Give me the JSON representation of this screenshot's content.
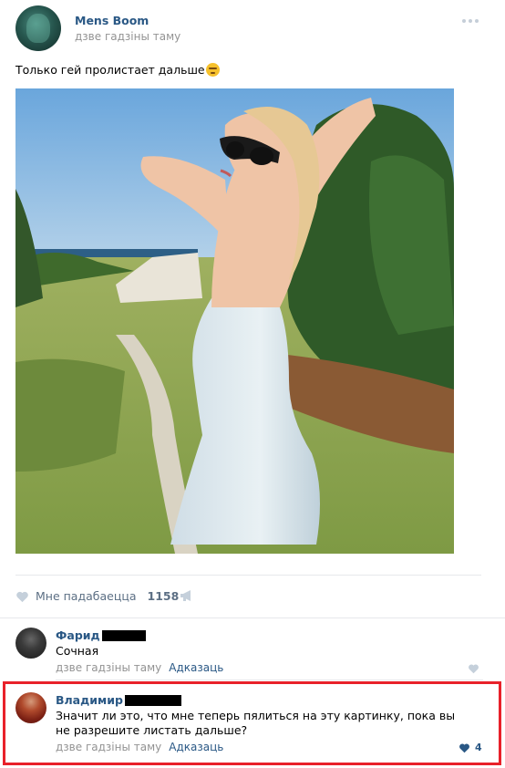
{
  "post": {
    "author": "Mens Boom",
    "time": "дзве гадзіны таму",
    "text": "Только гей пролистает дальше",
    "likes_label": "Мне падабаецца",
    "likes_count": "1158"
  },
  "comments": [
    {
      "name": "Фарид",
      "text": "Сочная",
      "time": "дзве гадзіны таму",
      "reply": "Адказаць",
      "likes": ""
    },
    {
      "name": "Владимир",
      "text": "Значит ли это, что мне теперь пялиться на эту картинку, пока вы не разрешите листать дальше?",
      "time": "дзве гадзіны таму",
      "reply": "Адказаць",
      "likes": "4"
    }
  ],
  "icons": {
    "more": "more-dots-icon",
    "like": "heart-icon",
    "share": "megaphone-share-icon",
    "emoji": "smirk-emoji-icon"
  },
  "colors": {
    "link": "#2a5885",
    "muted": "#939393",
    "highlight": "#e8212a"
  }
}
